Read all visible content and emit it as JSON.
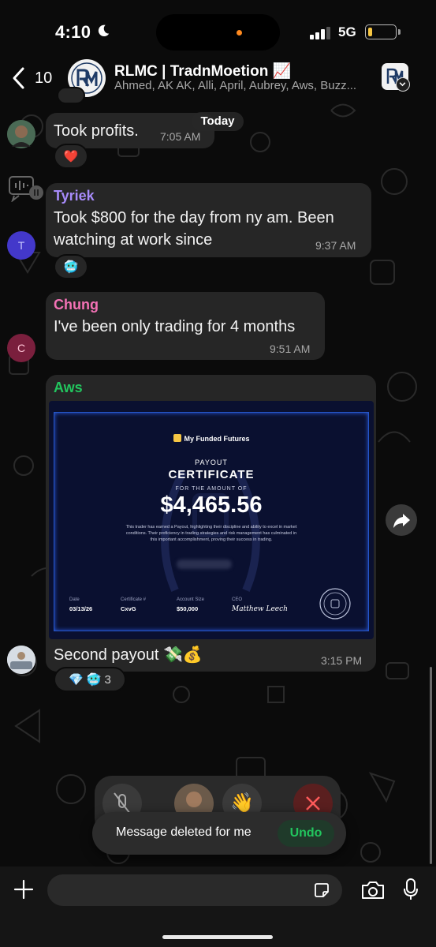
{
  "status_bar": {
    "time": "4:10",
    "network": "5G",
    "battery_level": 0.15
  },
  "header": {
    "back_count": "10",
    "group_name": "RLMC | TradnMoetion 📈",
    "members": "Ahmed, AK AK, Alli, April, Aubrey, Aws, Buzz...",
    "logo_text": "RLMC"
  },
  "date_divider": "Today",
  "messages": [
    {
      "text": "Took profits.",
      "time": "7:05 AM",
      "reactions": [
        "❤️"
      ]
    },
    {
      "sender": "Tyriek",
      "sender_color": "#a78bfa",
      "avatar_initial": "T",
      "text_line1": "Took $800 for the day from ny am. Been",
      "text_line2": "watching at work since",
      "time": "9:37 AM",
      "reactions": [
        "🥶"
      ]
    },
    {
      "sender": "Chung",
      "sender_color": "#f472b6",
      "avatar_initial": "C",
      "text": "I've been only trading for 4 months",
      "time": "9:51 AM"
    },
    {
      "sender": "Aws",
      "sender_color": "#22c55e",
      "certificate": {
        "brand": "My Funded Futures",
        "payout": "PAYOUT",
        "title": "CERTIFICATE",
        "subtitle": "FOR THE AMOUNT OF",
        "amount": "$4,465.56",
        "body_line1": "This trader has earned a Payout, highlighting their discipline and ability to excel in market",
        "body_line2": "conditions. Their proficiency in trading strategies and risk management has culminated in",
        "body_line3": "this important accomplishment, proving their success in trading.",
        "date_label": "Date",
        "date_value": "03/13/26",
        "cert_label": "Certificate #",
        "cert_value": "CxvG",
        "size_label": "Account Size",
        "size_value": "$50,000",
        "ceo_label": "CEO",
        "ceo_value": "Matthew Leech"
      },
      "text": "Second payout 💸💰",
      "time": "3:15 PM",
      "reactions": [
        "💎",
        "🥶"
      ],
      "reaction_count": "3"
    }
  ],
  "toast": {
    "text": "Message deleted for me",
    "undo": "Undo"
  },
  "composer": {
    "placeholder": ""
  }
}
